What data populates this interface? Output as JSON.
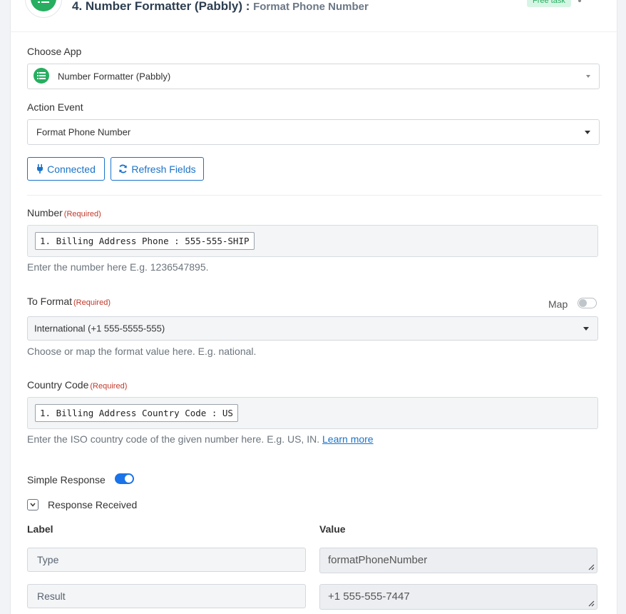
{
  "header": {
    "step_title": "4. Number Formatter (Pabbly) :",
    "step_subtitle": "Format Phone Number",
    "badge": "Free task"
  },
  "choose_app": {
    "label": "Choose App",
    "value": "Number Formatter (Pabbly)"
  },
  "action_event": {
    "label": "Action Event",
    "value": "Format Phone Number"
  },
  "buttons": {
    "connected": "Connected",
    "refresh": "Refresh Fields"
  },
  "number": {
    "label": "Number",
    "required": "(Required)",
    "chip": "1. Billing Address Phone : 555-555-SHIP",
    "help": "Enter the number here E.g. 1236547895."
  },
  "to_format": {
    "label": "To Format",
    "required": "(Required)",
    "map_label": "Map",
    "map_on": false,
    "value": "International (+1 555-5555-555)",
    "help": "Choose or map the format value here. E.g. national."
  },
  "country_code": {
    "label": "Country Code",
    "required": "(Required)",
    "chip": "1. Billing Address Country Code : US",
    "help": "Enter the ISO country code of the given number here. E.g. US, IN.",
    "learn_more": "Learn more"
  },
  "simple_response": {
    "label": "Simple Response",
    "on": true
  },
  "response": {
    "title": "Response Received",
    "col_label": "Label",
    "col_value": "Value",
    "rows": [
      {
        "label": "Type",
        "value": "formatPhoneNumber"
      },
      {
        "label": "Result",
        "value": "+1 555-555-7447"
      }
    ]
  },
  "colors": {
    "accent": "#1a73c8",
    "app_green": "#27ae60",
    "required_red": "#c0392b"
  }
}
